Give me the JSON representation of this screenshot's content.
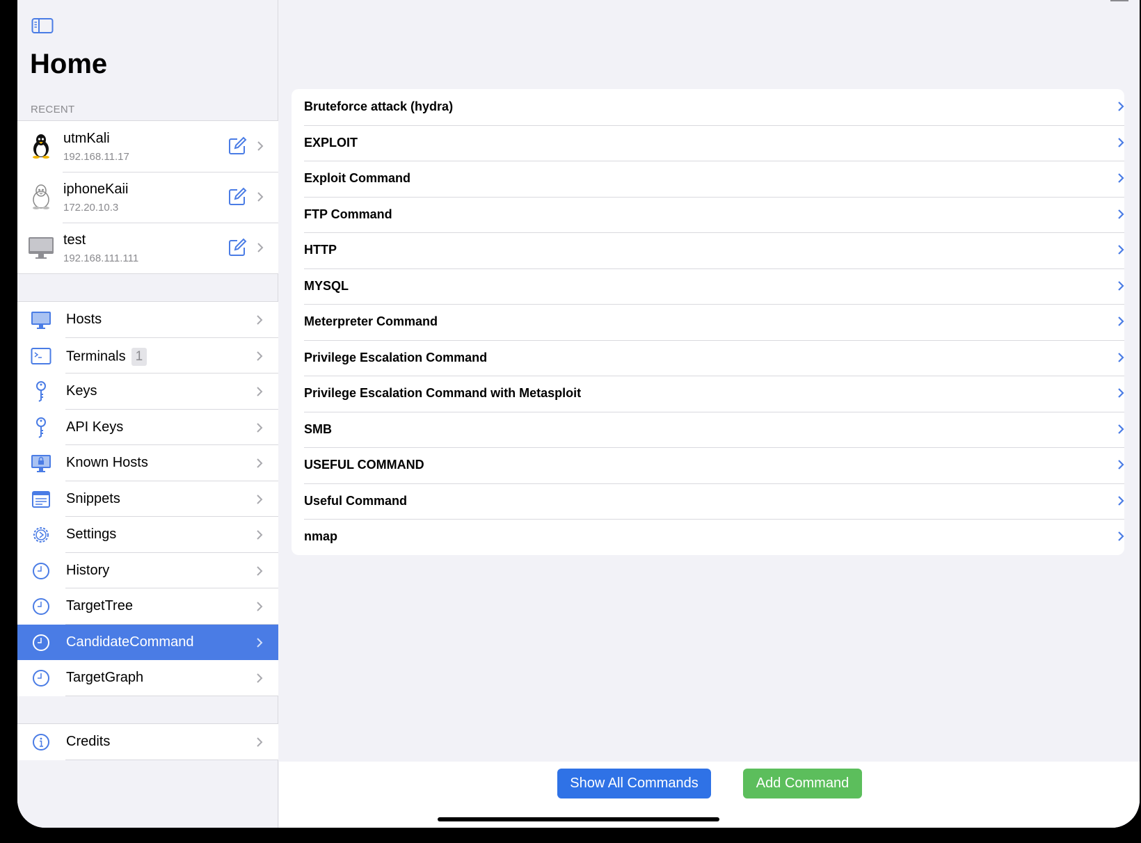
{
  "sidebar": {
    "title": "Home",
    "recent_label": "RECENT",
    "recent": [
      {
        "name": "utmKali",
        "ip": "192.168.11.17",
        "icon": "linux-penguin-icon"
      },
      {
        "name": "iphoneKaii",
        "ip": "172.20.10.3",
        "icon": "linux-penguin-icon"
      },
      {
        "name": "test",
        "ip": "192.168.111.111",
        "icon": "desktop-computer-icon"
      }
    ],
    "nav": [
      {
        "label": "Hosts",
        "icon": "monitor-icon"
      },
      {
        "label": "Terminals",
        "icon": "terminal-icon",
        "badge": "1"
      },
      {
        "label": "Keys",
        "icon": "key-icon"
      },
      {
        "label": "API Keys",
        "icon": "key-icon"
      },
      {
        "label": "Known Hosts",
        "icon": "locked-monitor-icon"
      },
      {
        "label": "Snippets",
        "icon": "snippet-icon"
      },
      {
        "label": "Settings",
        "icon": "gear-icon"
      },
      {
        "label": "History",
        "icon": "clock-icon"
      },
      {
        "label": "TargetTree",
        "icon": "clock-icon"
      },
      {
        "label": "CandidateCommand",
        "icon": "clock-icon",
        "selected": true
      },
      {
        "label": "TargetGraph",
        "icon": "clock-icon"
      }
    ],
    "credits": {
      "label": "Credits",
      "icon": "info-icon"
    }
  },
  "main": {
    "commands": [
      "Bruteforce attack (hydra)",
      "EXPLOIT",
      "Exploit Command",
      "FTP Command",
      "HTTP",
      "MYSQL",
      "Meterpreter Command",
      "Privilege Escalation Command",
      "Privilege Escalation Command with Metasploit",
      "SMB",
      "USEFUL COMMAND",
      "Useful Command",
      "nmap"
    ],
    "show_all_label": "Show All Commands",
    "add_label": "Add Command"
  },
  "colors": {
    "accent": "#4a7ce5",
    "show_button": "#2f72e6",
    "add_button": "#5cbe5c",
    "chevron_main": "#4a7ce5",
    "chevron_sidebar": "#a9a9ae"
  }
}
